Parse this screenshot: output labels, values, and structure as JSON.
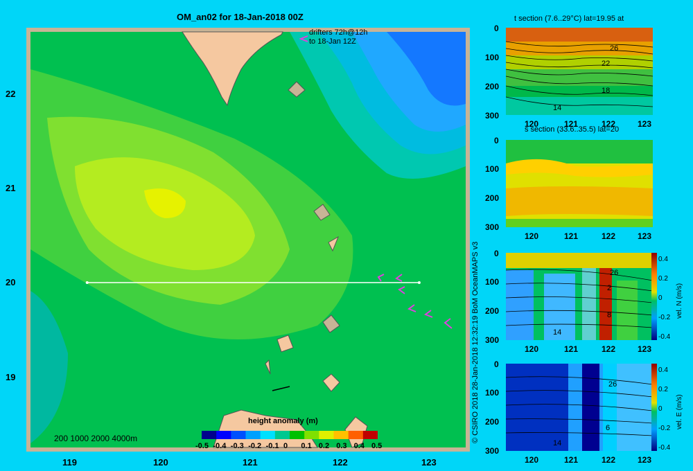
{
  "map": {
    "title": "OM_an02 for 18-Jan-2018 00Z",
    "drifters_line1": "drifters 72h@12h",
    "drifters_line2": "to 18-Jan 12Z",
    "lat_ticks": [
      "22",
      "21",
      "20",
      "19"
    ],
    "lon_ticks": [
      "119",
      "120",
      "121",
      "122",
      "123"
    ],
    "depth_legend": "200  1000  2000  4000m",
    "section_line": {
      "lat": 20,
      "lon_start": 119.5,
      "lon_end": 123.2
    }
  },
  "colorbar": {
    "title": "height anomaly (m)",
    "labels": [
      "-0.5",
      "-0.4",
      "-0.3",
      "-0.2",
      "-0.1",
      "0",
      "0.1",
      "0.2",
      "0.3",
      "0.4",
      "0.5"
    ],
    "colors": [
      "#00008c",
      "#0000ff",
      "#0050ff",
      "#00a0ff",
      "#00e0ff",
      "#00c890",
      "#00c000",
      "#80e000",
      "#e0f000",
      "#ffc000",
      "#ff6000",
      "#c00000"
    ]
  },
  "credit": "© CSIRO 2018   28-Jan-2018 12:32:19 BoM OceanMAPS v3",
  "panels": [
    {
      "title": "t section (7.6..29°C) lat=19.95 at",
      "contours": [
        "26",
        "22",
        "18",
        "14"
      ],
      "side_label": "",
      "cbar": false
    },
    {
      "title": "s section (33.6..35.5) lat=20",
      "contours": [],
      "side_label": "",
      "cbar": false
    },
    {
      "title": "",
      "contours": [
        "26",
        "2",
        "8",
        "14"
      ],
      "side_label": "vel. N (m/s)",
      "cbar": true
    },
    {
      "title": "",
      "contours": [
        "26",
        "6",
        "14"
      ],
      "side_label": "vel. E (m/s)",
      "cbar": true
    }
  ],
  "panel_depth_ticks": [
    "0",
    "100",
    "200",
    "300"
  ],
  "panel_lon_ticks": [
    "120",
    "121",
    "122",
    "123"
  ],
  "panel_cbar_ticks": [
    "0.4",
    "0.2",
    "0",
    "-0.2",
    "-0.4"
  ]
}
